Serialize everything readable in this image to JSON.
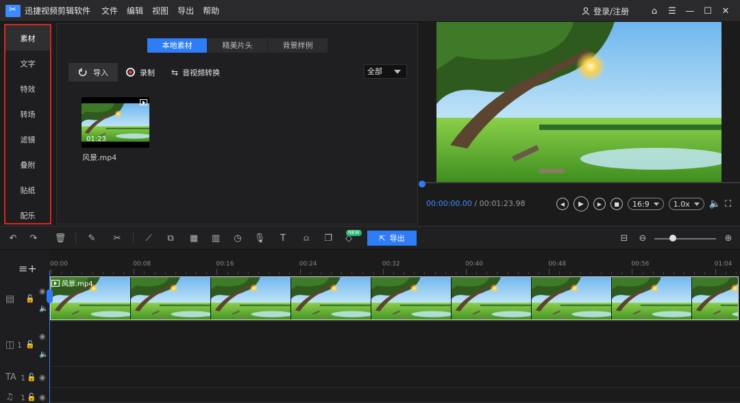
{
  "app": {
    "title": "迅捷视频剪辑软件",
    "menu": [
      "文件",
      "编辑",
      "视图",
      "导出",
      "帮助"
    ],
    "login_label": "登录/注册"
  },
  "sidebar": {
    "items": [
      {
        "label": "素材",
        "active": true
      },
      {
        "label": "文字"
      },
      {
        "label": "特效"
      },
      {
        "label": "转场"
      },
      {
        "label": "滤镜"
      },
      {
        "label": "叠附"
      },
      {
        "label": "贴纸"
      },
      {
        "label": "配乐"
      }
    ]
  },
  "library": {
    "tabs": [
      {
        "label": "本地素材",
        "active": true
      },
      {
        "label": "精美片头"
      },
      {
        "label": "背景样例"
      }
    ],
    "import_label": "导入",
    "record_label": "录制",
    "convert_label": "音视频转换",
    "filter_value": "全部",
    "media": [
      {
        "name": "风景.mp4",
        "duration": "01:23"
      }
    ]
  },
  "preview": {
    "current_time": "00:00:00.00",
    "separator": " / ",
    "total_time": "00:01:23.98",
    "aspect_ratio": "16:9",
    "speed": "1.0x"
  },
  "toolbar": {
    "export_label": "导出",
    "new_badge": "NEW",
    "zoom_level": 0.3
  },
  "timeline": {
    "ticks": [
      "00:00",
      "00:08",
      "00:16",
      "00:24",
      "00:32",
      "00:40",
      "00:48",
      "00:56",
      "01:04"
    ],
    "clip_name": "风景.mp4",
    "track_numbers": {
      "overlay": "1",
      "text": "1",
      "music": "1"
    }
  },
  "colors": {
    "accent": "#2f7df6",
    "highlight_border": "#d8281e",
    "panel_bg": "#1f1f21"
  }
}
